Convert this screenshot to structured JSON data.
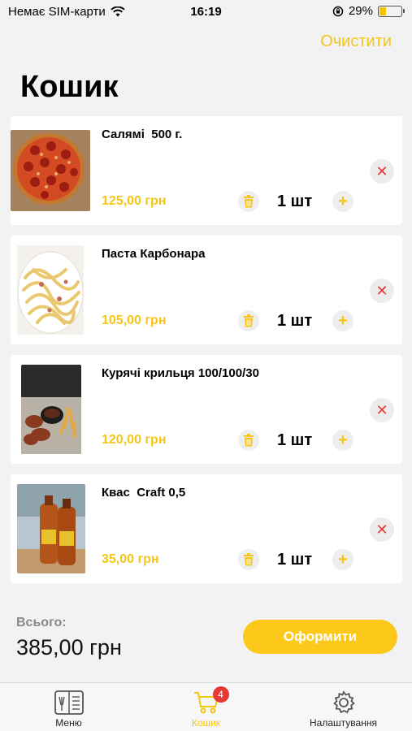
{
  "status_bar": {
    "carrier": "Немає SIM-карти",
    "time": "16:19",
    "battery": "29%",
    "battery_level": 0.29
  },
  "header": {
    "clear_label": "Очистити",
    "title": "Кошик"
  },
  "cart": {
    "items": [
      {
        "name": "Салямі  500 г.",
        "price": "125,00 грн",
        "qty": "1 шт",
        "thumb": "pizza"
      },
      {
        "name": "Паста Карбонара",
        "price": "105,00 грн",
        "qty": "1 шт",
        "thumb": "pasta"
      },
      {
        "name": "Курячі крильця 100/100/30",
        "price": "120,00 грн",
        "qty": "1 шт",
        "thumb": "wings"
      },
      {
        "name": "Квас  Craft 0,5",
        "price": "35,00 грн",
        "qty": "1 шт",
        "thumb": "kvass"
      }
    ]
  },
  "summary": {
    "total_label": "Всього:",
    "total_value": "385,00 грн",
    "checkout_label": "Оформити"
  },
  "tabs": {
    "menu": {
      "label": "Меню",
      "icon": "menu-book-icon"
    },
    "cart": {
      "label": "Кошик",
      "icon": "cart-icon",
      "badge": "4"
    },
    "settings": {
      "label": "Налаштування",
      "icon": "gear-icon"
    }
  },
  "colors": {
    "accent": "#f5c518",
    "button": "#fcc91a",
    "remove": "#e53935",
    "badge": "#e53935"
  }
}
